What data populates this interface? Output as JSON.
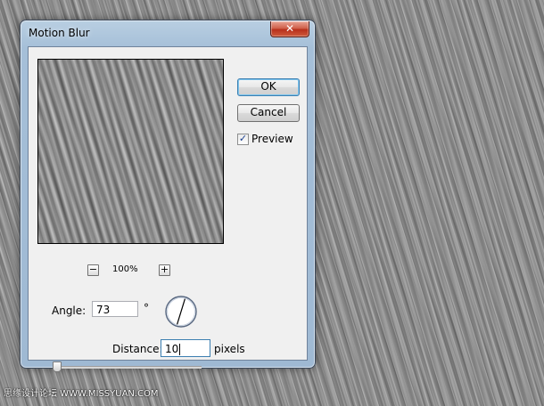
{
  "dialog": {
    "title": "Motion Blur",
    "close_glyph": "✕",
    "ok_label": "OK",
    "cancel_label": "Cancel",
    "preview_checkbox": {
      "label": "Preview",
      "checked": true,
      "check_glyph": "✓"
    }
  },
  "zoom": {
    "level": "100%",
    "minus_glyph": "−",
    "plus_glyph": "+"
  },
  "angle": {
    "label": "Angle:",
    "value": "73",
    "unit": "°"
  },
  "distance": {
    "label": "Distance:",
    "value": "10",
    "unit": "pixels",
    "slider_fraction": 0.0
  },
  "watermark": "思缘设计论坛 WWW.MISSYUAN.COM"
}
